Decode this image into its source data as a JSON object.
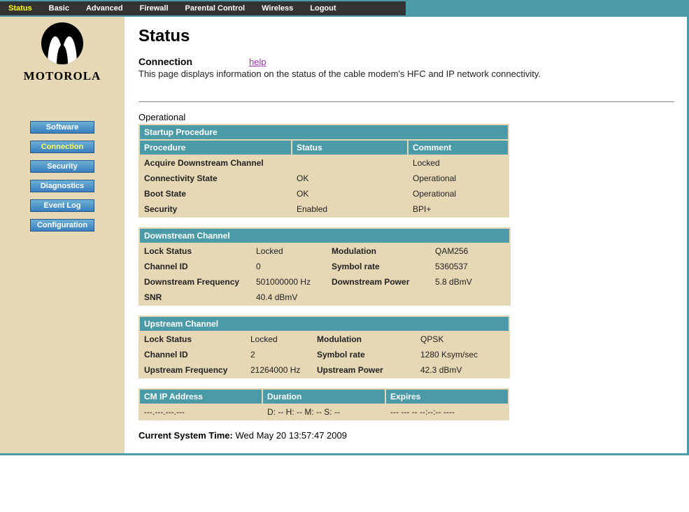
{
  "top_nav": {
    "items": [
      "Status",
      "Basic",
      "Advanced",
      "Firewall",
      "Parental Control",
      "Wireless",
      "Logout"
    ],
    "active": 0
  },
  "brand": "MOTOROLA",
  "side_nav": {
    "items": [
      "Software",
      "Connection",
      "Security",
      "Diagnostics",
      "Event Log",
      "Configuration"
    ],
    "active": 1
  },
  "page": {
    "title": "Status",
    "section": "Connection",
    "help": "help",
    "description": "This page displays information on the status of the cable modem's HFC and IP network connectivity.",
    "state": "Operational"
  },
  "tables": {
    "startup": {
      "title": "Startup Procedure",
      "headers": [
        "Procedure",
        "Status",
        "Comment"
      ],
      "rows": [
        [
          "Acquire Downstream Channel",
          "",
          "Locked"
        ],
        [
          "Connectivity State",
          "OK",
          "Operational"
        ],
        [
          "Boot State",
          "OK",
          "Operational"
        ],
        [
          "Security",
          "Enabled",
          "BPI+"
        ]
      ],
      "widths": [
        216,
        164,
        142
      ]
    },
    "downstream": {
      "title": "Downstream Channel",
      "rows": [
        [
          "Lock Status",
          "Locked",
          "Modulation",
          "QAM256"
        ],
        [
          "Channel ID",
          "0",
          "Symbol rate",
          "5360537"
        ],
        [
          "Downstream Frequency",
          "501000000 Hz",
          "Downstream Power",
          "5.8 dBmV"
        ],
        [
          "SNR",
          "40.4 dBmV",
          "",
          ""
        ]
      ],
      "widths": [
        158,
        106,
        146,
        112
      ]
    },
    "upstream": {
      "title": "Upstream Channel",
      "rows": [
        [
          "Lock Status",
          "Locked",
          "Modulation",
          "QPSK"
        ],
        [
          "Channel ID",
          "2",
          "Symbol rate",
          "1280 Ksym/sec"
        ],
        [
          "Upstream Frequency",
          "21264000 Hz",
          "Upstream Power",
          "42.3 dBmV"
        ]
      ],
      "widths": [
        150,
        93,
        146,
        132
      ]
    },
    "cmip": {
      "headers": [
        "CM IP Address",
        "Duration",
        "Expires"
      ],
      "rows": [
        [
          "---.---.---.---",
          "D: -- H: -- M: -- S: --",
          "--- --- -- --:--:-- ----"
        ]
      ],
      "widths": [
        174,
        174,
        174
      ]
    }
  },
  "system_time": {
    "label": "Current System Time:",
    "value": "Wed May 20 13:57:47 2009"
  }
}
